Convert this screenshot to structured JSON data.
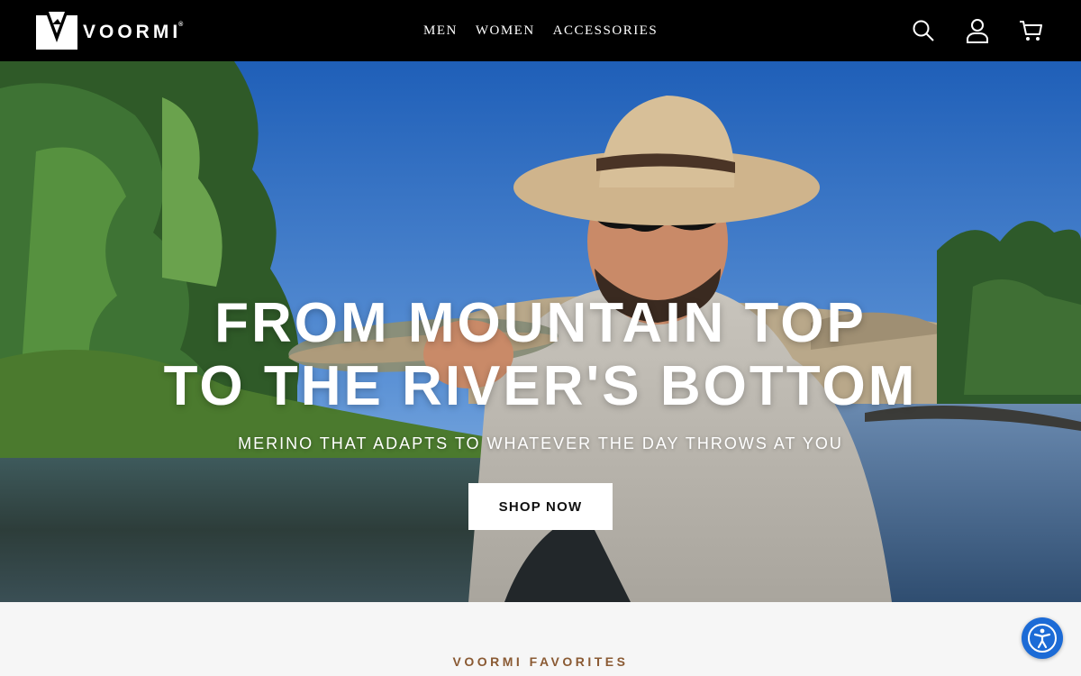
{
  "header": {
    "brand": "VOORMI",
    "brand_mark": "®",
    "nav": [
      {
        "label": "MEN"
      },
      {
        "label": "WOMEN"
      },
      {
        "label": "ACCESSORIES"
      }
    ],
    "icons": [
      "search-icon",
      "account-icon",
      "cart-icon"
    ]
  },
  "hero": {
    "title_line1": "FROM MOUNTAIN TOP",
    "title_line2": "TO THE RIVER'S BOTTOM",
    "subtitle": "MERINO THAT ADAPTS TO WHATEVER THE DAY THROWS AT YOU",
    "cta_label": "SHOP NOW",
    "image_subject": "angler in straw hat and sunglasses holding a trout on a river with trees and hills"
  },
  "section": {
    "heading": "VOORMI FAVORITES"
  },
  "colors": {
    "header_bg": "#000000",
    "accent_brown": "#8a5a33",
    "accessibility_blue": "#1c6bd6",
    "section_bg": "#f6f6f6"
  }
}
